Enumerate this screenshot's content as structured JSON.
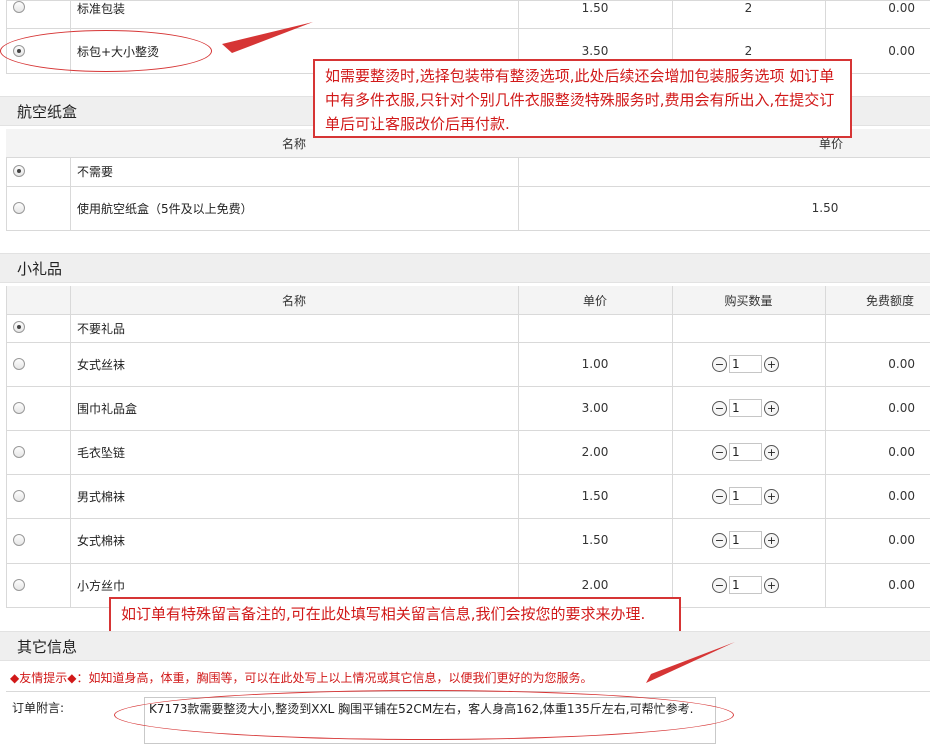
{
  "packaging": {
    "rows": [
      {
        "name": "标准包装",
        "price": "1.50",
        "qty": "2",
        "free": "0.00",
        "checked": false
      },
      {
        "name": "标包+大小整烫",
        "price": "3.50",
        "qty": "2",
        "free": "0.00",
        "checked": true
      }
    ]
  },
  "callouts": {
    "ironing": "如需要整烫时,选择包装带有整烫选项,此处后续还会增加包装服务选项 如订单中有多件衣服,只针对个别几件衣服整烫特殊服务时,费用会有所出入,在提交订单后可让客服改价后再付款.",
    "message": "如订单有特殊留言备注的,可在此处填写相关留言信息,我们会按您的要求来办理."
  },
  "air_box": {
    "title": "航空纸盒",
    "headers": {
      "name": "名称",
      "price": "单价"
    },
    "rows": [
      {
        "name": "不需要",
        "price": "",
        "checked": true
      },
      {
        "name": "使用航空纸盒（5件及以上免费）",
        "price": "1.50",
        "checked": false
      }
    ]
  },
  "gifts": {
    "title": "小礼品",
    "headers": {
      "name": "名称",
      "price": "单价",
      "qty": "购买数量",
      "free": "免费额度"
    },
    "no_gift": "不要礼品",
    "rows": [
      {
        "name": "女式丝袜",
        "price": "1.00",
        "qty": "1",
        "free": "0.00"
      },
      {
        "name": "围巾礼品盒",
        "price": "3.00",
        "qty": "1",
        "free": "0.00"
      },
      {
        "name": "毛衣坠链",
        "price": "2.00",
        "qty": "1",
        "free": "0.00"
      },
      {
        "name": "男式棉袜",
        "price": "1.50",
        "qty": "1",
        "free": "0.00"
      },
      {
        "name": "女式棉袜",
        "price": "1.50",
        "qty": "1",
        "free": "0.00"
      },
      {
        "name": "小方丝巾",
        "price": "2.00",
        "qty": "1",
        "free": "0.00"
      }
    ]
  },
  "other": {
    "title": "其它信息",
    "tip": "◆友情提示◆：如知道身高，体重，胸围等，可以在此处写上以上情况或其它信息，以便我们更好的为您服务。",
    "note_label": "订单附言:",
    "note_value": "K7173款需要整烫大小,整烫到XXL 胸围平铺在52CM左右，客人身高162,体重135斤左右,可帮忙参考."
  },
  "colors": {
    "accent_red": "#d63535",
    "section_bg": "#efefef"
  }
}
